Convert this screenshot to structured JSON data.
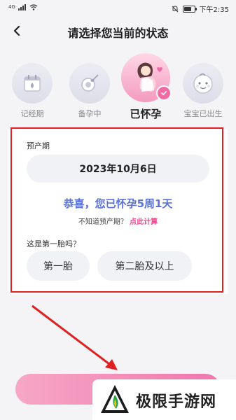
{
  "status_bar": {
    "signal_text": "4G",
    "time": "下午2:35"
  },
  "header": {
    "title": "请选择您当前的状态"
  },
  "stages": [
    {
      "label": "记经期",
      "icon": "calendar-drop-icon",
      "active": false
    },
    {
      "label": "备孕中",
      "icon": "sperm-egg-icon",
      "active": false
    },
    {
      "label": "已怀孕",
      "icon": "pregnant-woman-icon",
      "active": true
    },
    {
      "label": "宝宝已出生",
      "icon": "baby-face-icon",
      "active": false
    }
  ],
  "card": {
    "due_label": "预产期",
    "due_date": "2023年10月6日",
    "congrats": "恭喜，您已怀孕5周1天",
    "hint_text": "不知道预产期？",
    "calc_link": "点此计算",
    "first_question": "这是第一胎吗？",
    "options": [
      "第一胎",
      "第二胎及以上"
    ]
  },
  "watermark": {
    "text": "极限手游网"
  },
  "colors": {
    "accent_pink": "#f06aa4",
    "congrats_blue": "#5a72d8",
    "highlight_red": "#e02020"
  }
}
